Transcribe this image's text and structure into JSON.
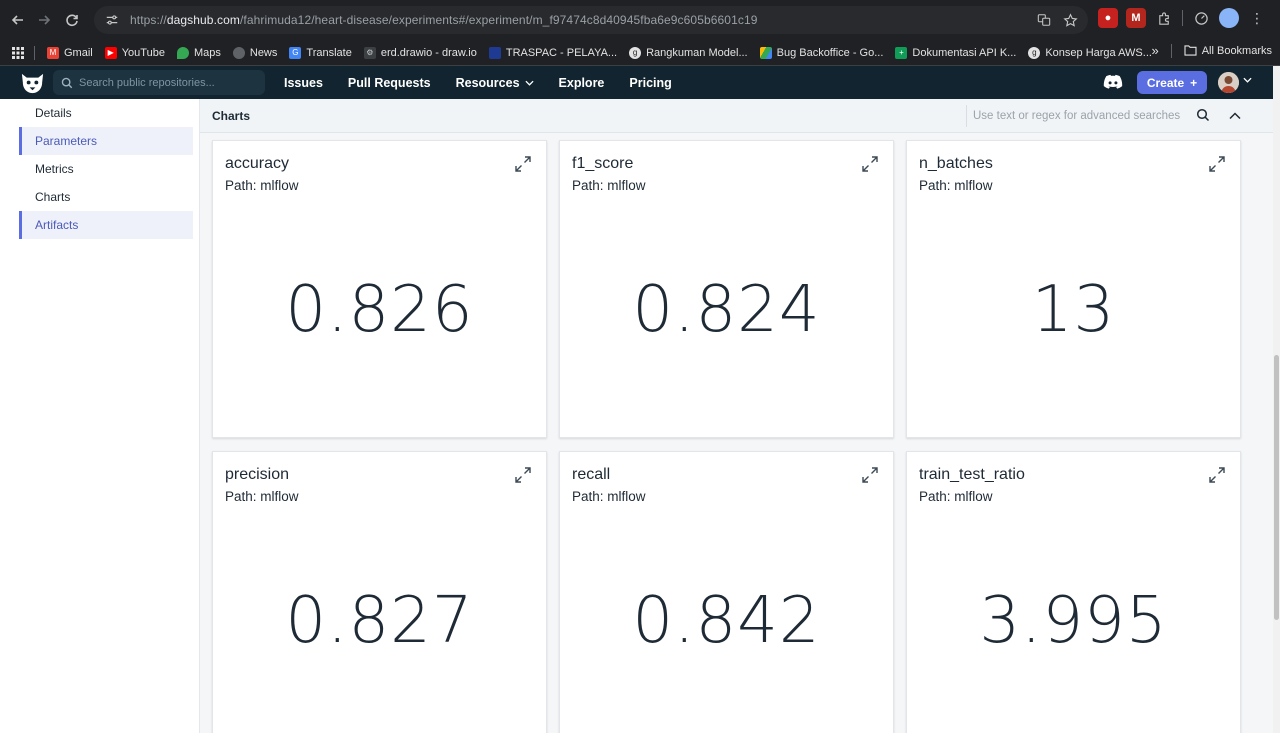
{
  "browser": {
    "url_prefix": "https://",
    "url_host": "dagshub.com",
    "url_path": "/fahrimuda12/heart-disease/experiments#/experiment/m_f97474c8d40945fba6e9c605b6601c19"
  },
  "bookmarks": [
    {
      "label": "Gmail",
      "color": "#ea4335"
    },
    {
      "label": "YouTube",
      "color": "#ff0000"
    },
    {
      "label": "Maps",
      "color": "#34a853"
    },
    {
      "label": "News",
      "color": "#4285f4"
    },
    {
      "label": "Translate",
      "color": "#4285f4"
    },
    {
      "label": "erd.drawio - draw.io",
      "color": "#f08705"
    },
    {
      "label": "TRASPAC - PELAYA...",
      "color": "#1f3a93"
    },
    {
      "label": "Rangkuman Model...",
      "color": "#5f6368"
    },
    {
      "label": "Bug Backoffice - Go...",
      "color": "#fbbc04"
    },
    {
      "label": "Dokumentasi API K...",
      "color": "#0f9d58"
    },
    {
      "label": "Konsep Harga AWS...",
      "color": "#5f6368"
    }
  ],
  "bookmarks_all": "All Bookmarks",
  "nav": {
    "search_placeholder": "Search public repositories...",
    "links": [
      "Issues",
      "Pull Requests",
      "Resources",
      "Explore",
      "Pricing"
    ],
    "create_label": "Create"
  },
  "sidebar": {
    "items": [
      {
        "label": "Details",
        "active": false
      },
      {
        "label": "Parameters",
        "active": true
      },
      {
        "label": "Metrics",
        "active": false
      },
      {
        "label": "Charts",
        "active": false
      },
      {
        "label": "Artifacts",
        "active": true
      }
    ]
  },
  "charts": {
    "title": "Charts",
    "search_placeholder": "Use text or regex for advanced searches",
    "cards": [
      {
        "name": "accuracy",
        "path": "Path: mlflow",
        "value": "0.826"
      },
      {
        "name": "f1_score",
        "path": "Path: mlflow",
        "value": "0.824"
      },
      {
        "name": "n_batches",
        "path": "Path: mlflow",
        "value": "13"
      },
      {
        "name": "precision",
        "path": "Path: mlflow",
        "value": "0.827"
      },
      {
        "name": "recall",
        "path": "Path: mlflow",
        "value": "0.842"
      },
      {
        "name": "train_test_ratio",
        "path": "Path: mlflow",
        "value": "3.995"
      }
    ]
  }
}
